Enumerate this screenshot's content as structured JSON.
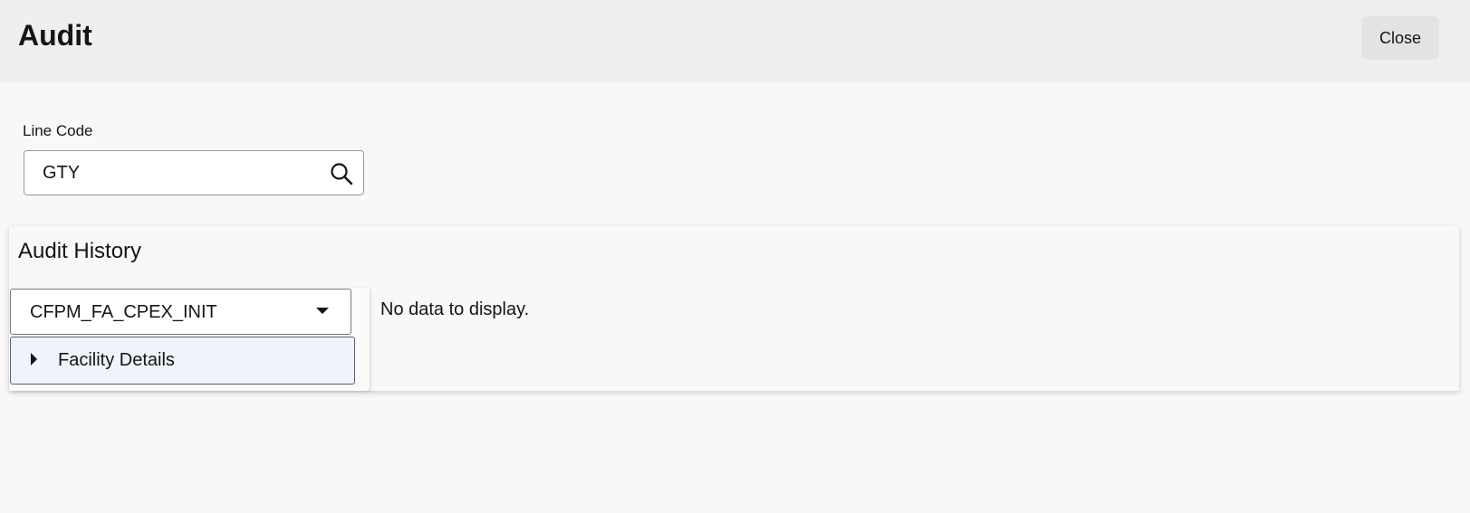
{
  "header": {
    "title": "Audit",
    "close_label": "Close"
  },
  "line_code": {
    "label": "Line Code",
    "value": "GTY",
    "icon": "search-icon"
  },
  "audit_history": {
    "title": "Audit History",
    "selected_process": "CFPM_FA_CPEX_INIT",
    "tree": [
      {
        "label": "Facility Details",
        "expanded": false
      }
    ],
    "empty_message": "No data to display."
  },
  "colors": {
    "header_bg": "#f0efed",
    "page_bg": "#f9f8f6",
    "selected_node_bg": "#eef3fc",
    "close_button_bg": "#e4e3e1"
  }
}
